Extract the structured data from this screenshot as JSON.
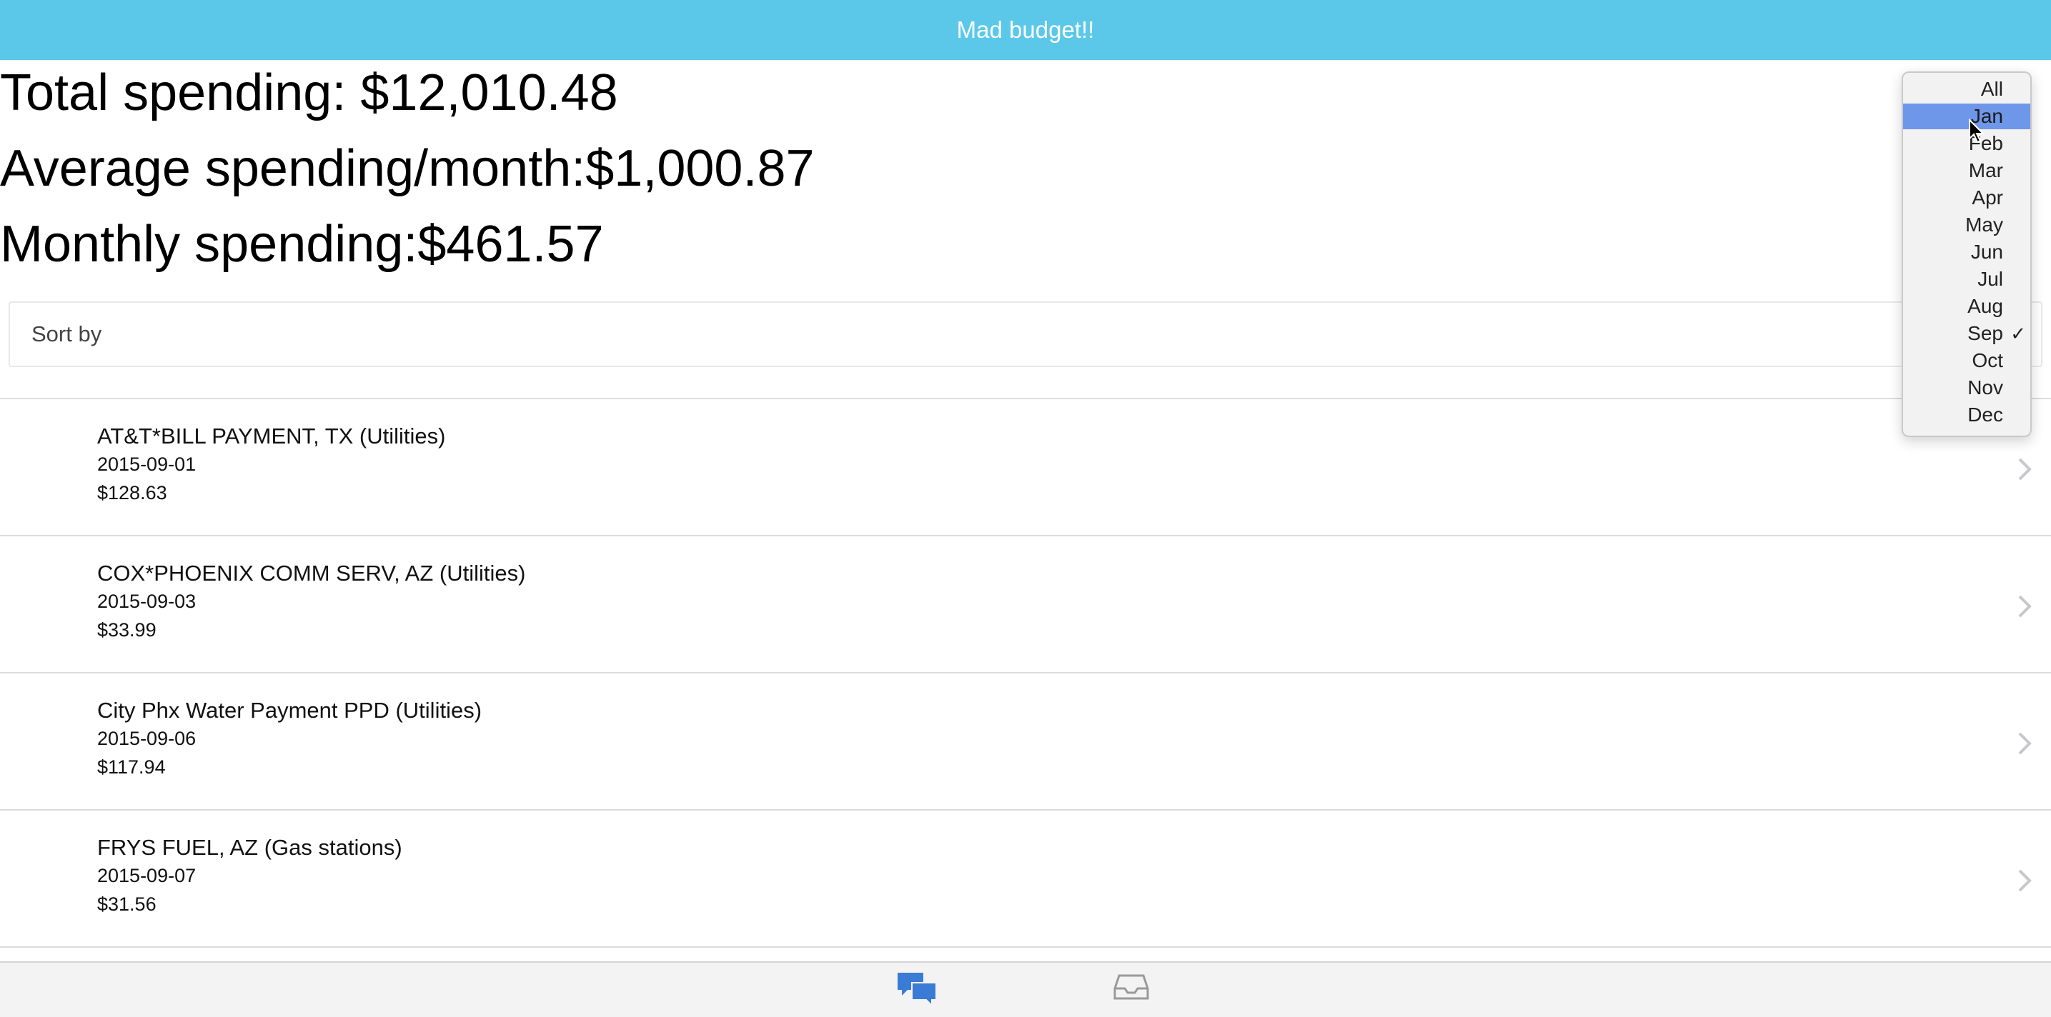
{
  "header": {
    "title": "Mad budget!!"
  },
  "stats": {
    "total": "Total spending: $12,010.48",
    "average": "Average spending/month:$1,000.87",
    "monthly": "Monthly spending:$461.57"
  },
  "sort": {
    "label": "Sort by"
  },
  "transactions": [
    {
      "title": "AT&T*BILL PAYMENT, TX (Utilities)",
      "date": "2015-09-01",
      "amount": "$128.63"
    },
    {
      "title": "COX*PHOENIX COMM SERV, AZ (Utilities)",
      "date": "2015-09-03",
      "amount": "$33.99"
    },
    {
      "title": "City Phx Water Payment PPD (Utilities)",
      "date": "2015-09-06",
      "amount": "$117.94"
    },
    {
      "title": "FRYS FUEL, AZ (Gas stations)",
      "date": "2015-09-07",
      "amount": "$31.56"
    }
  ],
  "month_dropdown": {
    "options": [
      "All",
      "Jan",
      "Feb",
      "Mar",
      "Apr",
      "May",
      "Jun",
      "Jul",
      "Aug",
      "Sep",
      "Oct",
      "Nov",
      "Dec"
    ],
    "highlighted": "Jan",
    "selected": "Sep",
    "check_mark": "✓"
  },
  "tabbar": {
    "tabs": [
      {
        "icon": "chat-bubbles-icon",
        "color": "#3a7bd5"
      },
      {
        "icon": "inbox-tray-icon",
        "color": "#9a9a9a"
      }
    ]
  },
  "colors": {
    "header": "#5bc8ea",
    "highlight": "#6e97ea"
  }
}
